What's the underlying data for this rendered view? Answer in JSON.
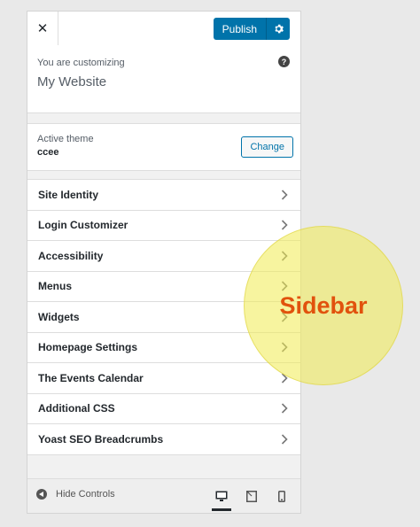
{
  "topbar": {
    "close_label": "✕",
    "publish_label": "Publish"
  },
  "info": {
    "customizing_label": "You are customizing",
    "site_name": "My Website"
  },
  "theme": {
    "label": "Active theme",
    "value": "ccee",
    "change_label": "Change"
  },
  "menu": [
    {
      "label": "Site Identity"
    },
    {
      "label": "Login Customizer"
    },
    {
      "label": "Accessibility"
    },
    {
      "label": "Menus"
    },
    {
      "label": "Widgets"
    },
    {
      "label": "Homepage Settings"
    },
    {
      "label": "The Events Calendar"
    },
    {
      "label": "Additional CSS"
    },
    {
      "label": "Yoast SEO Breadcrumbs"
    }
  ],
  "footer": {
    "hide_controls_label": "Hide Controls",
    "active_device": "desktop"
  },
  "callout": {
    "label": "Sidebar",
    "color": "#e1520d"
  },
  "colors": {
    "accent": "#0073aa"
  }
}
